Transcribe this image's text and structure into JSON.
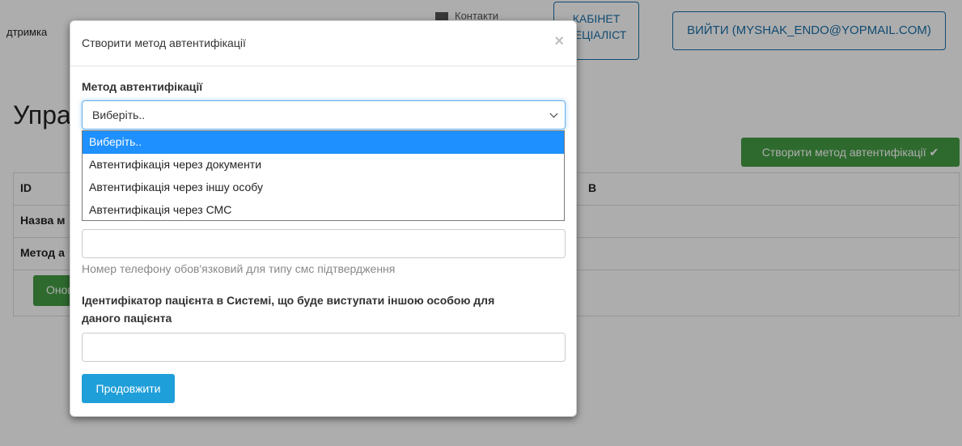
{
  "nav": {
    "support_text": "дтримка",
    "contacts_text": "Контакти",
    "cabinet_button_line1": "КАБІНЕТ",
    "cabinet_button_line2": "ПЕЦІАЛІСТ",
    "logout_button": "ВИЙТИ (MYSHAK_ENDO@YOPMAIL.COM)"
  },
  "page": {
    "title_partial": "Упра",
    "create_button": "Створити метод автентифікації ✔",
    "table": {
      "row_id_label": "ID",
      "row_name_label": "Назва м",
      "row_method_label": "Метод а",
      "col_right_fragment": "В"
    },
    "refresh_button_partial": "Онов"
  },
  "modal": {
    "title": "Створити метод автентифікації",
    "close_symbol": "×",
    "method_label": "Метод автентифікації",
    "select": {
      "selected_value": "Виберіть..",
      "options": [
        "Виберіть..",
        "Автентифікація через документи",
        "Автентифікація через іншу особу",
        "Автентифікація через СМС"
      ]
    },
    "phone_input_value": "",
    "phone_hint": "Номер телефону обов'язковий для типу смс підтвердження",
    "patient_id_label_line1": "Ідентифікатор пацієнта в Системі, що буде виступати іншою особою для",
    "patient_id_label_line2": "даного пацієнта",
    "patient_id_input_value": "",
    "continue_button": "Продовжити"
  },
  "colors": {
    "accent_blue": "#1f9fd9",
    "success_green": "#449d44",
    "outline_blue": "#1a6fa8",
    "dropdown_highlight": "#1e90ff"
  }
}
